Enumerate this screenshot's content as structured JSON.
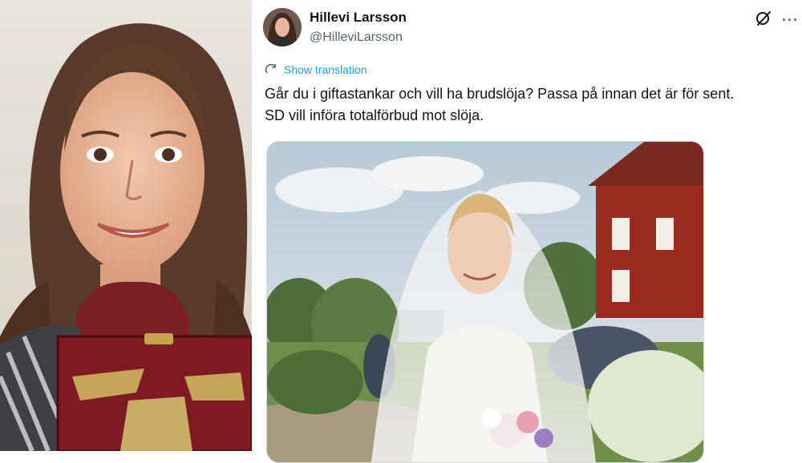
{
  "tweet": {
    "author_name": "Hillevi Larsson",
    "author_handle": "@HilleviLarsson",
    "translate_label": "Show translation",
    "text_line1": "Går du i giftastankar och vill ha brudslöja? Passa på innan det är för sent.",
    "text_line2": "SD vill införa totalförbud mot slöja.",
    "more_label": "···"
  },
  "icons": {
    "grok": "grok-icon",
    "more": "more-icon",
    "translate": "translate-icon"
  },
  "colors": {
    "link_blue": "#1d9bf0",
    "text_primary": "#0f1419",
    "text_secondary": "#536471"
  }
}
